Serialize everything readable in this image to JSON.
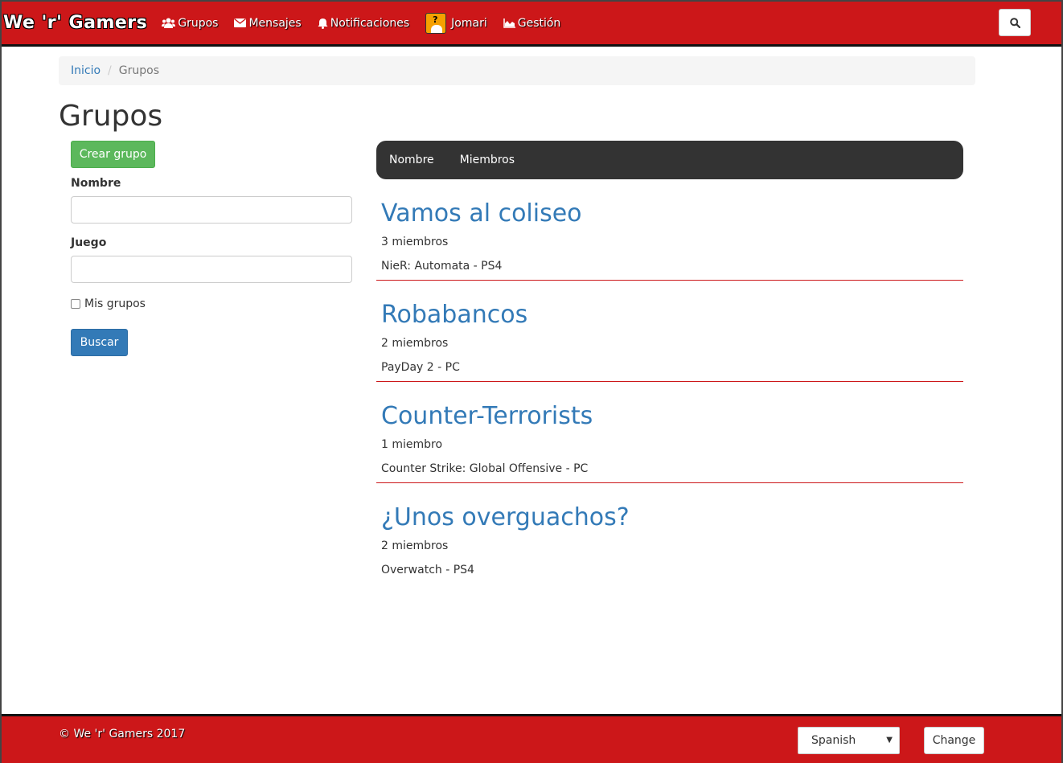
{
  "navbar": {
    "brand": "We 'r' Gamers",
    "items": [
      {
        "label": "Grupos",
        "icon": "users-icon"
      },
      {
        "label": "Mensajes",
        "icon": "envelope-icon"
      },
      {
        "label": "Notificaciones",
        "icon": "bell-icon"
      },
      {
        "label": "Jomari",
        "icon": "avatar"
      },
      {
        "label": "Gestión",
        "icon": "area-chart-icon"
      }
    ],
    "search_icon": "search-icon"
  },
  "breadcrumb": {
    "home": "Inicio",
    "current": "Grupos"
  },
  "page": {
    "title": "Grupos"
  },
  "filters": {
    "create_label": "Crear grupo",
    "name_label": "Nombre",
    "name_value": "",
    "game_label": "Juego",
    "game_value": "",
    "my_groups_label": "Mis grupos",
    "my_groups_checked": false,
    "search_label": "Buscar"
  },
  "sort": {
    "name_label": "Nombre",
    "members_label": "Miembros"
  },
  "groups": [
    {
      "name": "Vamos al coliseo",
      "members": "3 miembros",
      "game": "NieR: Automata - PS4"
    },
    {
      "name": "Robabancos",
      "members": "2 miembros",
      "game": "PayDay 2 - PC"
    },
    {
      "name": "Counter-Terrorists",
      "members": "1 miembro",
      "game": "Counter Strike: Global Offensive - PC"
    },
    {
      "name": "¿Unos overguachos?",
      "members": "2 miembros",
      "game": "Overwatch - PS4"
    }
  ],
  "footer": {
    "copyright": "© We 'r' Gamers 2017",
    "language": "Spanish",
    "change_label": "Change"
  },
  "colors": {
    "brand_red": "#cc1719",
    "link_blue": "#337ab7",
    "success_green": "#5cb85c",
    "sortbar_dark": "#333333"
  }
}
